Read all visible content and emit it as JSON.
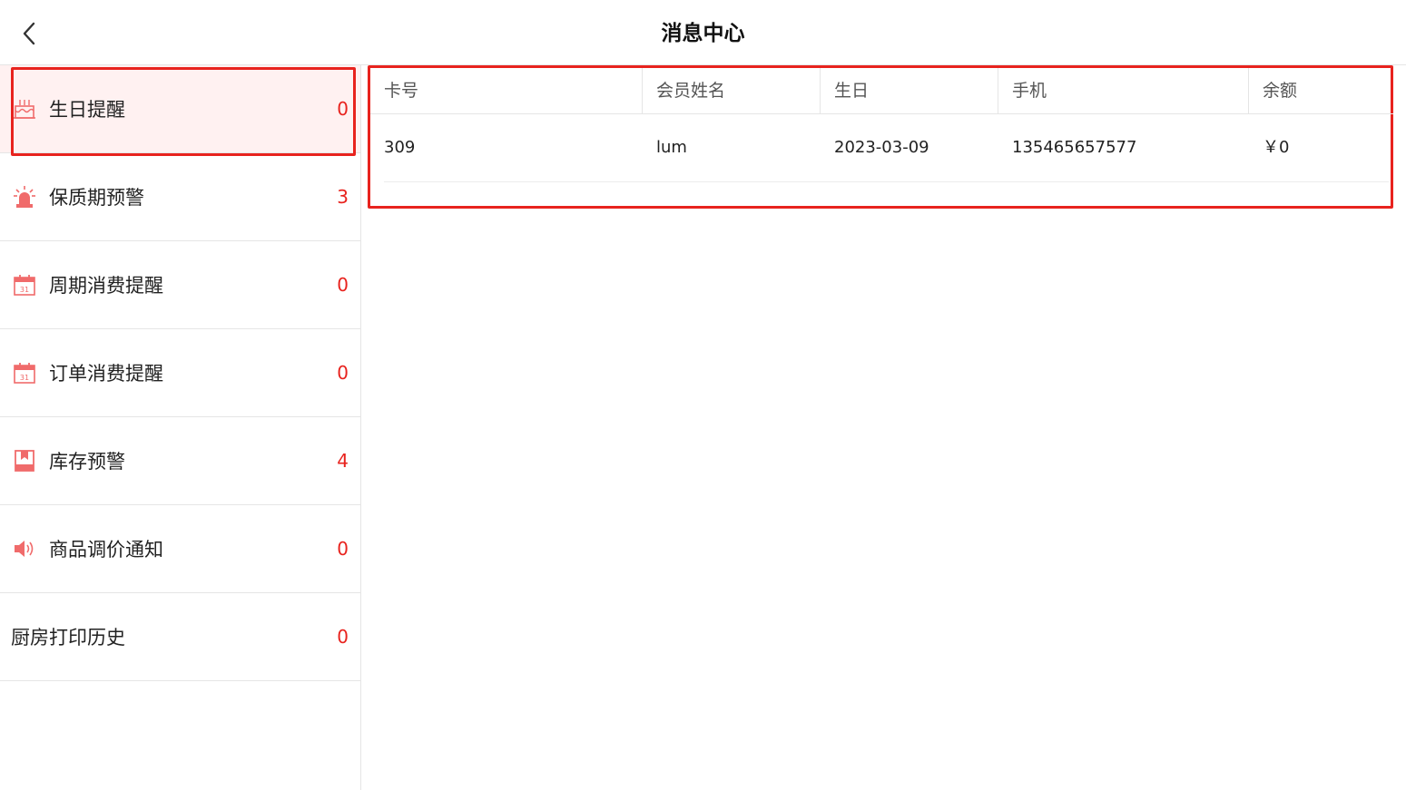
{
  "header": {
    "title": "消息中心"
  },
  "sidebar": {
    "items": [
      {
        "label": "生日提醒",
        "count": "0",
        "icon": "birthday-cake-icon",
        "active": true
      },
      {
        "label": "保质期预警",
        "count": "3",
        "icon": "alarm-light-icon"
      },
      {
        "label": "周期消费提醒",
        "count": "0",
        "icon": "calendar-icon"
      },
      {
        "label": "订单消费提醒",
        "count": "0",
        "icon": "calendar-icon"
      },
      {
        "label": "库存预警",
        "count": "4",
        "icon": "bookmark-box-icon"
      },
      {
        "label": "商品调价通知",
        "count": "0",
        "icon": "speaker-icon"
      },
      {
        "label": "厨房打印历史",
        "count": "0",
        "icon": ""
      }
    ]
  },
  "table": {
    "columns": [
      "卡号",
      "会员姓名",
      "生日",
      "手机",
      "余额"
    ],
    "rows": [
      [
        "309",
        "lum",
        "2023-03-09",
        "135465657577",
        "￥0"
      ]
    ]
  },
  "colors": {
    "accent": "#e8231e",
    "active_bg": "#fff1f1",
    "icon": "#f06b6b"
  }
}
